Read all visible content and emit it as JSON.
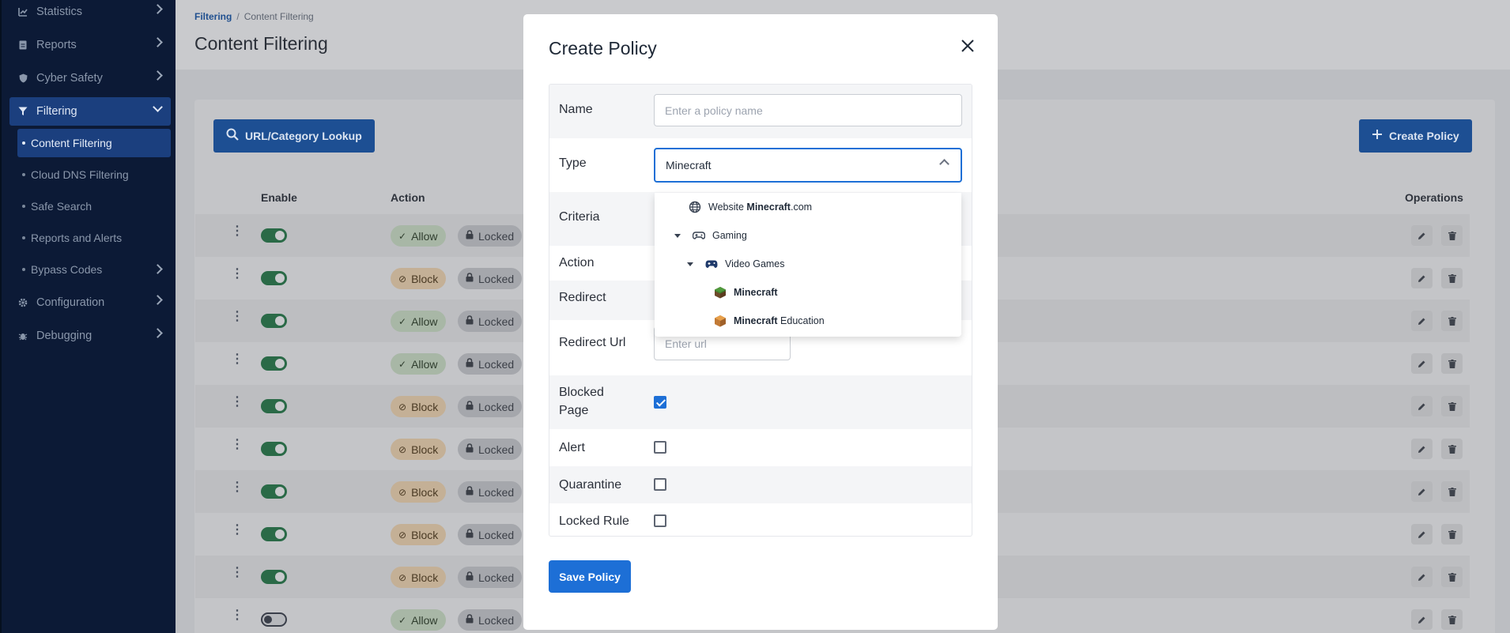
{
  "sidebar": {
    "items": [
      {
        "label": "Statistics"
      },
      {
        "label": "Reports"
      },
      {
        "label": "Cyber Safety"
      },
      {
        "label": "Filtering"
      },
      {
        "label": "Configuration"
      },
      {
        "label": "Debugging"
      }
    ],
    "sub_items": [
      {
        "label": "Content Filtering"
      },
      {
        "label": "Cloud DNS Filtering"
      },
      {
        "label": "Safe Search"
      },
      {
        "label": "Reports and Alerts"
      },
      {
        "label": "Bypass Codes"
      }
    ]
  },
  "page": {
    "breadcrumb_root": "Filtering",
    "breadcrumb_separator": "/",
    "breadcrumb_current": "Content Filtering",
    "title": "Content Filtering",
    "lookup_button": "URL/Category Lookup",
    "create_button": "Create Policy"
  },
  "table": {
    "headers": {
      "enable": "Enable",
      "action": "Action",
      "operations": "Operations"
    },
    "rows": [
      {
        "enabled": true,
        "action": "Allow",
        "lock": "Locked"
      },
      {
        "enabled": true,
        "action": "Block",
        "lock": "Locked"
      },
      {
        "enabled": true,
        "action": "Allow",
        "lock": "Locked"
      },
      {
        "enabled": true,
        "action": "Allow",
        "lock": "Locked"
      },
      {
        "enabled": true,
        "action": "Block",
        "lock": "Locked"
      },
      {
        "enabled": true,
        "action": "Block",
        "lock": "Locked"
      },
      {
        "enabled": true,
        "action": "Block",
        "lock": "Locked"
      },
      {
        "enabled": true,
        "action": "Block",
        "lock": "Locked"
      },
      {
        "enabled": true,
        "action": "Block",
        "lock": "Locked"
      },
      {
        "enabled": false,
        "action": "Allow",
        "lock": "Locked"
      }
    ]
  },
  "modal": {
    "title": "Create Policy",
    "fields": {
      "name_label": "Name",
      "name_placeholder": "Enter a policy name",
      "type_label": "Type",
      "type_value": "Minecraft",
      "criteria_label": "Criteria",
      "action_label": "Action",
      "redirect_label": "Redirect",
      "redirect_url_label": "Redirect Url",
      "redirect_url_placeholder": "Enter url",
      "blocked_page_label_1": "Blocked",
      "blocked_page_label_2": "Page",
      "blocked_page_checked": true,
      "alert_label": "Alert",
      "alert_checked": false,
      "quarantine_label": "Quarantine",
      "quarantine_checked": false,
      "locked_rule_label": "Locked Rule",
      "locked_rule_checked": false
    },
    "save_button": "Save Policy"
  },
  "dropdown": {
    "items": [
      {
        "prefix": "Website ",
        "bold": "Minecraft",
        "suffix": ".com",
        "icon": "globe-icon"
      },
      {
        "prefix": "Gaming",
        "bold": "",
        "suffix": "",
        "icon": "gamepad-icon"
      },
      {
        "prefix": "Video Games",
        "bold": "",
        "suffix": "",
        "icon": "controller-icon"
      },
      {
        "prefix": "",
        "bold": "Minecraft",
        "suffix": "",
        "icon": "minecraft-block-icon"
      },
      {
        "prefix": "",
        "bold": "Minecraft",
        "suffix": " Education",
        "icon": "minecraft-education-icon"
      }
    ]
  },
  "colors": {
    "sidebar_bg": "#0c1a36",
    "sidebar_active": "#1b3f7e",
    "primary": "#1d6fd6",
    "toggle_on": "#2a6a47"
  }
}
